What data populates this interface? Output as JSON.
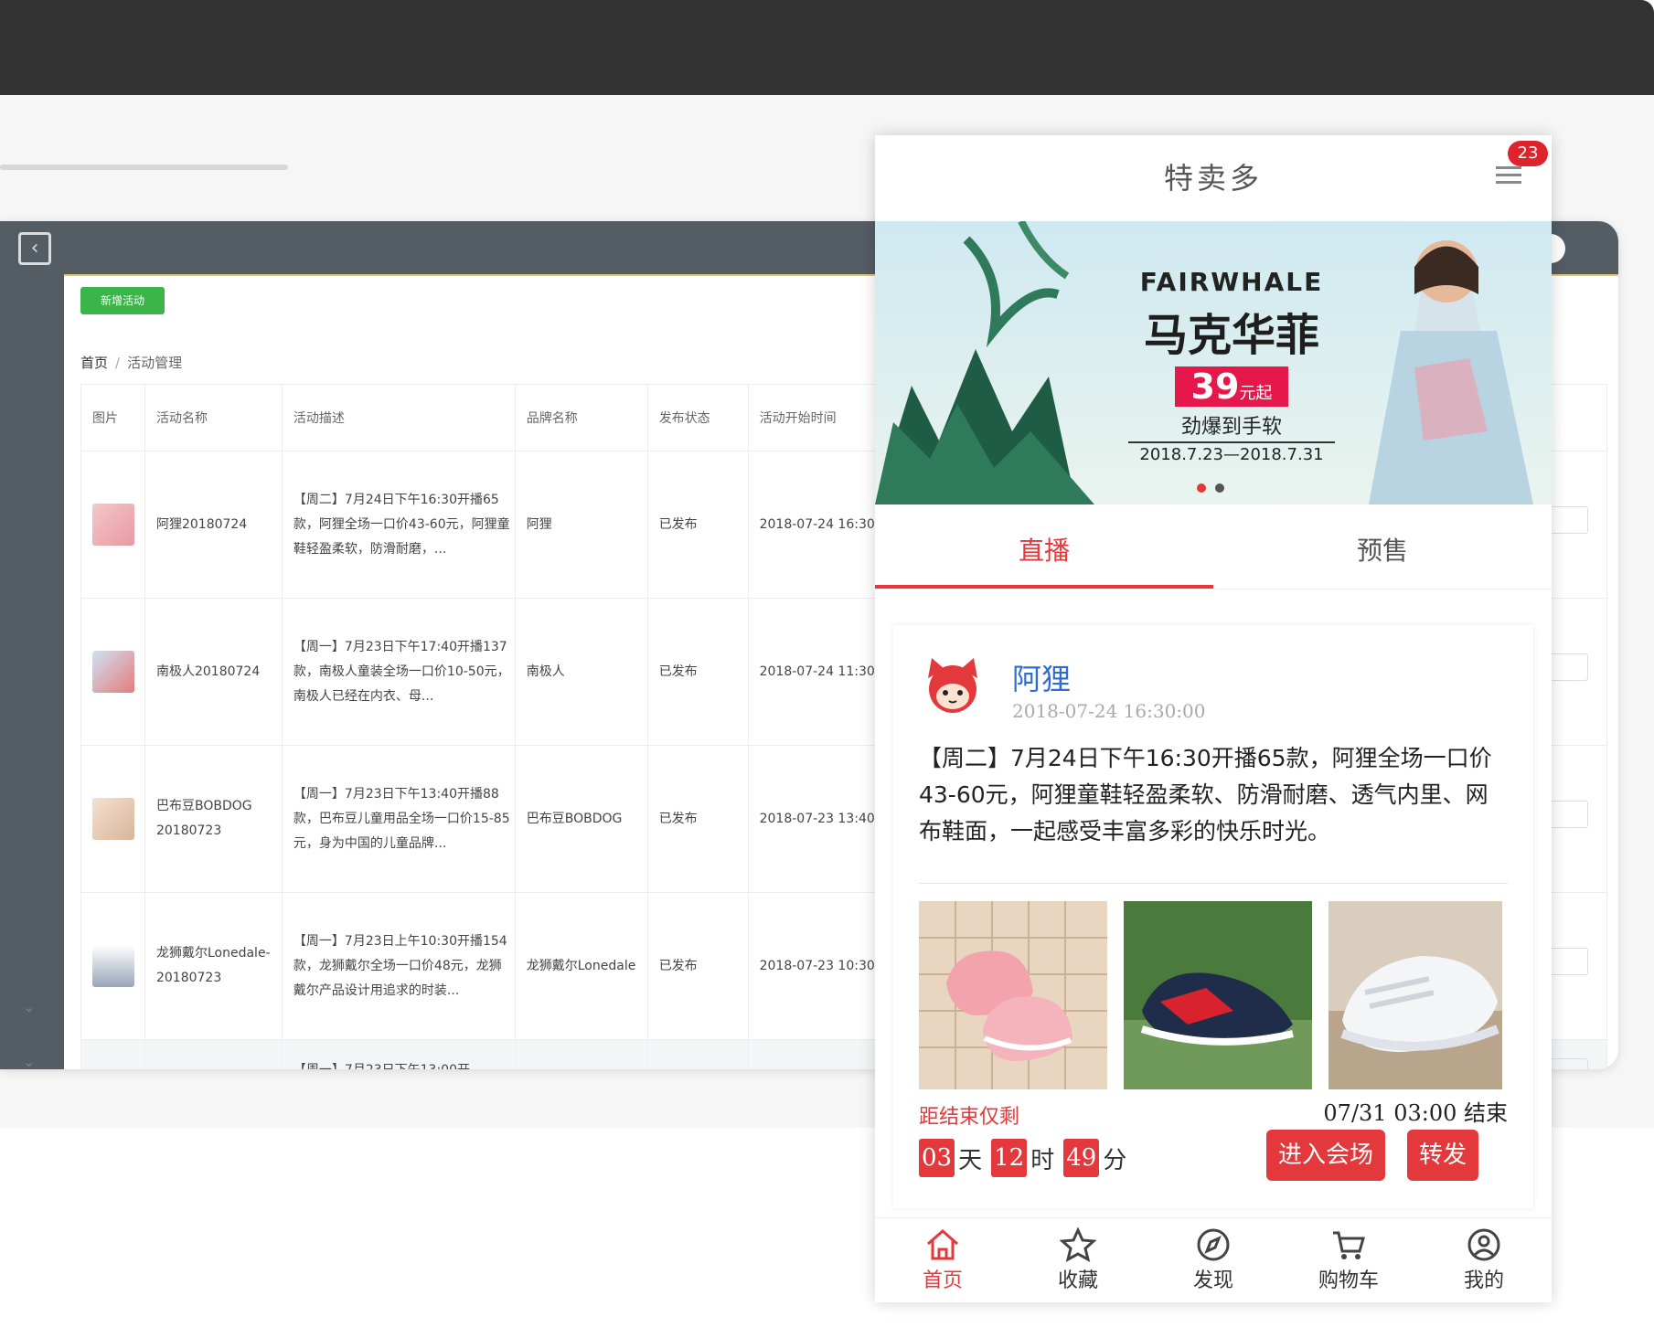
{
  "admin": {
    "new_button": "新增活动",
    "breadcrumb": {
      "home": "首页",
      "separator": "/",
      "current": "活动管理"
    },
    "columns": [
      "图片",
      "活动名称",
      "活动描述",
      "品牌名称",
      "发布状态",
      "活动开始时间"
    ],
    "rows": [
      {
        "name": "阿狸20180724",
        "desc": "【周二】7月24日下午16:30开播65款，阿狸全场一口价43-60元，阿狸童鞋轻盈柔软，防滑耐磨，...",
        "brand": "阿狸",
        "status": "已发布",
        "start": "2018-07-24 16:30"
      },
      {
        "name": "南极人20180724",
        "desc": "【周一】7月23日下午17:40开播137款，南极人童装全场一口价10-50元，南极人已经在内衣、母...",
        "brand": "南极人",
        "status": "已发布",
        "start": "2018-07-24 11:30"
      },
      {
        "name": "巴布豆BOBDOG 20180723",
        "desc": "【周一】7月23日下午13:40开播88款，巴布豆儿童用品全场一口价15-85元，身为中国的儿童品牌...",
        "brand": "巴布豆BOBDOG",
        "status": "已发布",
        "start": "2018-07-23 13:40"
      },
      {
        "name": "龙狮戴尔Lonedale-20180723",
        "desc": "【周一】7月23日上午10:30开播154款，龙狮戴尔全场一口价48元，龙狮戴尔产品设计用追求的时装...",
        "brand": "龙狮戴尔Lonedale",
        "status": "已发布",
        "start": "2018-07-23 10:30"
      }
    ],
    "partial_row_desc": "【周一】7月23日下午13:00开"
  },
  "phone": {
    "title": "特卖多",
    "badge": "23",
    "banner": {
      "brand_en": "FAIRWHALE",
      "brand_cn": "马克华菲",
      "price": "39",
      "price_unit": "元起",
      "promo": "劲爆到手软",
      "dates": "2018.7.23—2018.7.31"
    },
    "tabs": [
      "直播",
      "预售"
    ],
    "card": {
      "store_name": "阿狸",
      "store_time": "2018-07-24 16:30:00",
      "description": "【周二】7月24日下午16:30开播65款，阿狸全场一口价43-60元，阿狸童鞋轻盈柔软、防滑耐磨、透气内里、网布鞋面，一起感受丰富多彩的快乐时光。",
      "countdown_label": "距结束仅剩",
      "end_time": "07/31 03:00 结束",
      "countdown": {
        "days": "03",
        "days_unit": "天",
        "hours": "12",
        "hours_unit": "时",
        "minutes": "49",
        "minutes_unit": "分"
      },
      "enter_button": "进入会场",
      "share_button": "转发"
    },
    "nav": [
      "首页",
      "收藏",
      "发现",
      "购物车",
      "我的"
    ]
  },
  "colors": {
    "accent": "#e4393c",
    "link": "#2e6bd3",
    "sidebar": "#545c64",
    "success": "#3bb54a"
  }
}
